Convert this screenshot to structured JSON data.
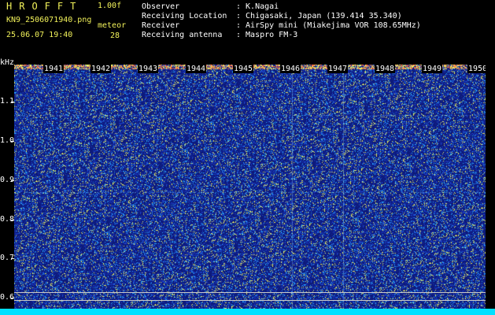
{
  "header": {
    "app_name": "HROFFT",
    "version": "1.00f",
    "file_name": "KN9_2506071940.png",
    "datetime": "25.06.07 19:40",
    "meteor_label": "meteor",
    "meteor_count": "28",
    "info": [
      {
        "key": "Observer",
        "value": ": K.Nagai"
      },
      {
        "key": "Receiving Location",
        "value": ": Chigasaki, Japan (139.414 35.340)"
      },
      {
        "key": "Receiver",
        "value": ": AirSpy mini (Miakejima VOR 108.65MHz)"
      },
      {
        "key": "Receiving antenna",
        "value": ": Maspro FM-3"
      }
    ]
  },
  "axis": {
    "unit": "kHz",
    "y_ticks": [
      "1.1",
      "1.0",
      "0.9",
      "0.8",
      "0.7",
      "0.6"
    ],
    "time_ticks": [
      "1941",
      "1942",
      "1943",
      "1944",
      "1945",
      "1946",
      "1947",
      "1948",
      "1949",
      "1950"
    ]
  },
  "colors": {
    "background": "#000000",
    "header_text": "#f2f25a",
    "info_text": "#ffffff",
    "spectrogram_base": "#0d1a7a",
    "noise_high": "#e8f060",
    "bottom_bar": "#00e0ff"
  }
}
